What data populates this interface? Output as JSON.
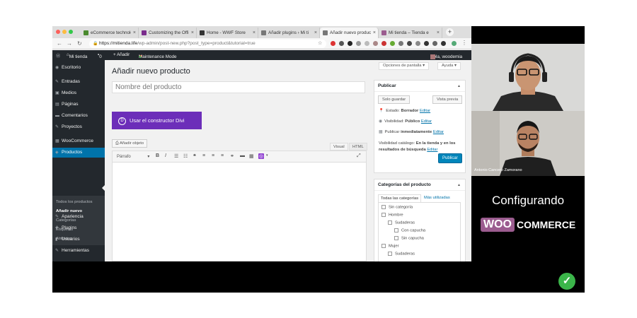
{
  "browser": {
    "tabs": [
      {
        "label": "eCommerce technolo",
        "color": "#4a8a2e"
      },
      {
        "label": "Customizing the Offi",
        "color": "#7a2c8c"
      },
      {
        "label": "Home - WWF Store",
        "color": "#333333"
      },
      {
        "label": "Añadir plugins › Mi ti",
        "color": "#777777"
      },
      {
        "label": "Añadir nuevo product",
        "color": "#777777"
      },
      {
        "label": "Mi tienda – Tienda e",
        "color": "#9b5c8f"
      }
    ],
    "active_tab": 4,
    "url_host": "https://mitienda.life",
    "url_path": "/wp-admin/post-new.php?post_type=product&tutorial=true"
  },
  "admin_bar": {
    "site": "Mi tienda",
    "comments": "0",
    "new": "+ Añadir",
    "maintenance": "Maintenance Mode",
    "greeting": "Hola, woodemia"
  },
  "sidebar": {
    "items": [
      {
        "label": "Escritorio",
        "icon": "dashboard-icon"
      },
      {
        "label": "Entradas",
        "icon": "pin-icon"
      },
      {
        "label": "Medios",
        "icon": "media-icon"
      },
      {
        "label": "Páginas",
        "icon": "pages-icon"
      },
      {
        "label": "Comentarios",
        "icon": "comments-icon"
      },
      {
        "label": "Proyectos",
        "icon": "projects-icon"
      },
      {
        "label": "WooCommerce",
        "icon": "woocommerce-icon"
      },
      {
        "label": "Productos",
        "icon": "products-icon"
      },
      {
        "label": "Apariencia",
        "icon": "appearance-icon"
      },
      {
        "label": "Plugins",
        "icon": "plugins-icon"
      },
      {
        "label": "Usuarios",
        "icon": "users-icon"
      },
      {
        "label": "Herramientas",
        "icon": "tools-icon"
      }
    ],
    "submenu": [
      "Todos los productos",
      "Añadir nuevo",
      "Categorías",
      "Etiquetas",
      "Atributos"
    ]
  },
  "screen": {
    "options": "Opciones de pantalla ▾",
    "help": "Ayuda ▾"
  },
  "page": {
    "title": "Añadir nuevo producto",
    "title_placeholder": "Nombre del producto",
    "divi_button": "Usar el constructor Divi",
    "add_media": "Añadir objeto",
    "editor_tab_visual": "Visual",
    "editor_tab_html": "HTML",
    "format_select": "Párrafo"
  },
  "publish": {
    "heading": "Publicar",
    "save_draft": "Solo guardar",
    "preview": "Vista previa",
    "status_label": "Estado:",
    "status_value": "Borrador",
    "visibility_label": "Visibilidad:",
    "visibility_value": "Público",
    "publish_label": "Publicar",
    "publish_value": "inmediatamente",
    "catalog_label": "Visibilidad catálogo:",
    "catalog_value_1": "En la tienda y en los",
    "catalog_value_2": "resultados de búsqueda",
    "edit": "Editar",
    "publish_button": "Publicar"
  },
  "categories": {
    "heading": "Categorías del producto",
    "tab_all": "Todas las categorías",
    "tab_used": "Más utilizadas",
    "items": [
      {
        "label": "Sin categoría",
        "level": 0
      },
      {
        "label": "Hombre",
        "level": 0
      },
      {
        "label": "Sudaderas",
        "level": 1
      },
      {
        "label": "Con capucha",
        "level": 2
      },
      {
        "label": "Sin capucha",
        "level": 2
      },
      {
        "label": "Mujer",
        "level": 0
      },
      {
        "label": "Sudaderas",
        "level": 1
      }
    ]
  },
  "video": {
    "presenter_name": "Antonio Cancero Zamorano",
    "caption": "Configurando",
    "brand_woo": "WOO",
    "brand_commerce": "COMMERCE"
  }
}
